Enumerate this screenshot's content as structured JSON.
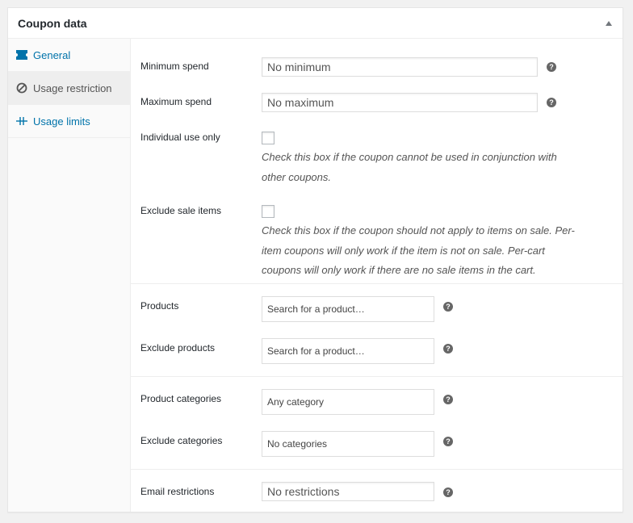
{
  "metabox": {
    "title": "Coupon data"
  },
  "tabs": [
    {
      "label": "General",
      "icon": "ticket-icon",
      "active": false
    },
    {
      "label": "Usage restriction",
      "icon": "block-icon",
      "active": true
    },
    {
      "label": "Usage limits",
      "icon": "limits-icon",
      "active": false
    }
  ],
  "fields": {
    "minimum_spend": {
      "label": "Minimum spend",
      "placeholder": "No minimum",
      "value": ""
    },
    "maximum_spend": {
      "label": "Maximum spend",
      "placeholder": "No maximum",
      "value": ""
    },
    "individual_use": {
      "label": "Individual use only",
      "checked": false,
      "description_lines": [
        "Check this box if the coupon cannot be used in conjunction with",
        "other coupons."
      ]
    },
    "exclude_sale_items": {
      "label": "Exclude sale items",
      "checked": false,
      "description_lines": [
        "Check this box if the coupon should not apply to items on sale. Per-",
        "item coupons will only work if the item is not on sale. Per-cart",
        "coupons will only work if there are no sale items in the cart."
      ]
    },
    "products": {
      "label": "Products",
      "placeholder": "Search for a product…"
    },
    "exclude_products": {
      "label": "Exclude products",
      "placeholder": "Search for a product…"
    },
    "product_categories": {
      "label": "Product categories",
      "placeholder": "Any category"
    },
    "exclude_categories": {
      "label": "Exclude categories",
      "placeholder": "No categories"
    },
    "email_restrictions": {
      "label": "Email restrictions",
      "placeholder": "No restrictions",
      "value": ""
    }
  },
  "colors": {
    "link": "#0073aa",
    "active_tab_bg": "#eeeeee",
    "help_icon": "#666666"
  }
}
